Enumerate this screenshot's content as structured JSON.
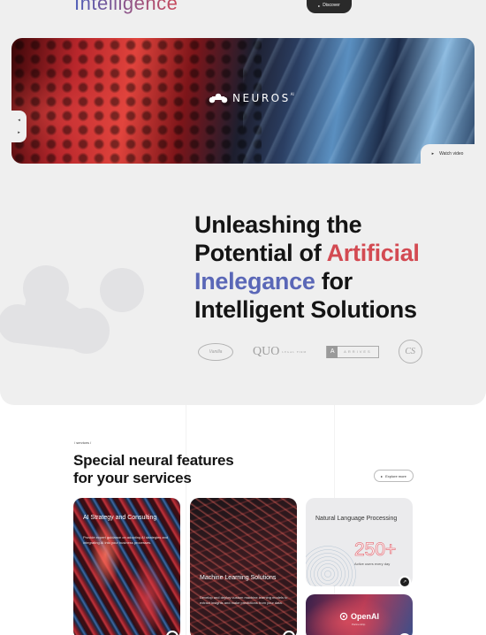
{
  "header": {
    "top_word": "Intelligence",
    "discover_label": "Discover"
  },
  "banner": {
    "brand_name": "NEUROS",
    "brand_mark": "AI",
    "prev_arrow": "◂",
    "next_arrow": "▸",
    "watch_video_label": "Watch video"
  },
  "hero": {
    "line1": "Unleashing the",
    "line2_plain": "Potential of ",
    "line2_highlight": "Artificial",
    "line3_highlight": "Inelegance",
    "line3_plain": " for",
    "line4": "Intelligent Solutions"
  },
  "partners": {
    "p1": "Vanilla",
    "p2_main": "QUO",
    "p2_small": "LEGAL FIRM",
    "p3_box": "A",
    "p3_text": "ARRIVES",
    "p4": "CS"
  },
  "features": {
    "eyebrow": "/ services /",
    "title_line1": "Special neural features",
    "title_line2": "for your services",
    "explore_label": "Explore more",
    "cards": [
      {
        "title": "AI Strategy and Consulting",
        "description": "Provide expert guidance on adopting AI strategies and integrating AI into your business processes."
      },
      {
        "title": "Machine Learning Solutions",
        "description": "Develop and deploy custom machine learning models to extract insights and make predictions from your data."
      },
      {
        "title": "Natural Language Processing",
        "stat": "250+",
        "stat_label": "Active users every day"
      },
      {
        "brand": "OpenAI",
        "brand_sub": "Partnership"
      }
    ]
  },
  "colors": {
    "accent_red": "#d34a52",
    "accent_blue": "#5a67b7",
    "dark": "#141414",
    "hero_bg": "#efefef"
  },
  "icons": {
    "arrow": "↗",
    "play": "▸"
  }
}
